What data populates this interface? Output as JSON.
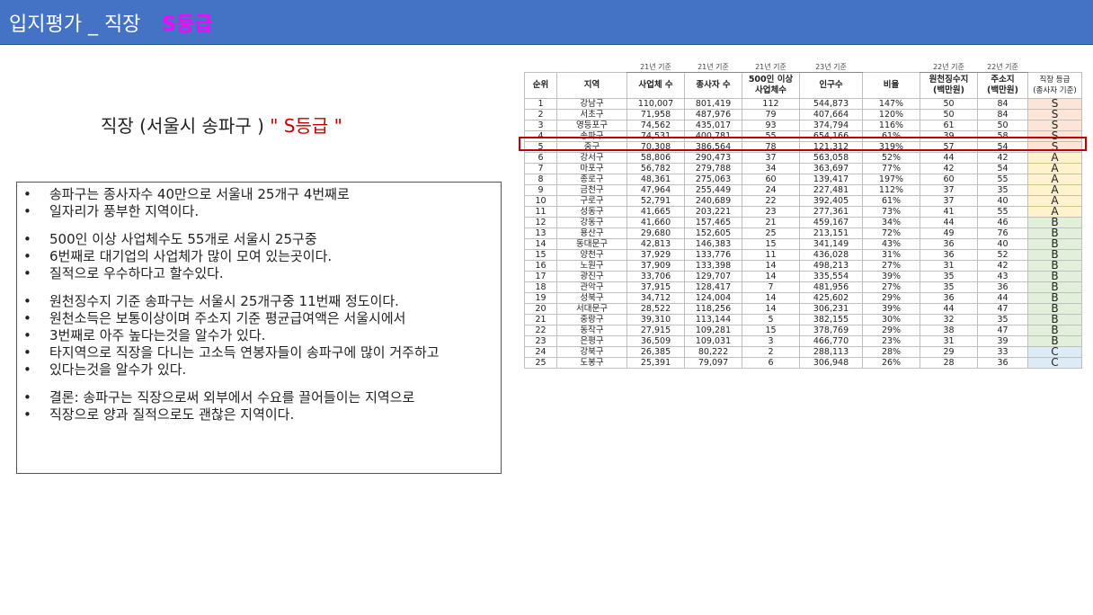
{
  "header": {
    "title": "입지평가 _ 직장",
    "grade": "S등급",
    "bg_color": "#4472c4",
    "grade_color": "#ff00ff"
  },
  "subtitle": {
    "prefix": "직장 (서울시 송파구 ) ",
    "quote": "\" S등급 \""
  },
  "bullets": [
    [
      "송파구는 종사자수 40만으로 서울내 25개구 4번째로",
      "일자리가 풍부한 지역이다."
    ],
    [
      "500인 이상 사업체수도 55개로 서울시 25구중",
      "6번째로 대기업의 사업체가 많이 모여 있는곳이다.",
      "질적으로 우수하다고 할수있다."
    ],
    [
      " 원천징수지 기준 송파구는 서울시 25개구중 11번째 정도이다.",
      "원천소득은 보통이상이며  주소지 기준 평균급여액은 서울시에서",
      "3번째로 아주 높다는것을 알수가 있다.",
      "타지역으로 직장을 다니는 고소득 연봉자들이 송파구에 많이 거주하고",
      "있다는것을 알수가 있다."
    ],
    [
      "결론: 송파구는 직장으로써 외부에서 수요를 끌어들이는 지역으로",
      "직장으로 양과 질적으로도 괜찮은 지역이다."
    ]
  ],
  "table": {
    "years": [
      "",
      "",
      "21년 기준",
      "21년 기준",
      "21년 기준",
      "23년 기준",
      "",
      "22년 기준",
      "22년 기준",
      ""
    ],
    "headers": [
      "순위",
      "지역",
      "사업체 수",
      "종사자 수",
      "500인 이상\n사업체수",
      "인구수",
      "비율",
      "원천징수지\n(백만원)",
      "주소지\n(백만원)",
      "직장 등급\n(종사자 기준)"
    ],
    "rows": [
      [
        "1",
        "강남구",
        "110,007",
        "801,419",
        "112",
        "544,873",
        "147%",
        "50",
        "84",
        "S"
      ],
      [
        "2",
        "서초구",
        "71,958",
        "487,976",
        "79",
        "407,664",
        "120%",
        "50",
        "84",
        "S"
      ],
      [
        "3",
        "영등포구",
        "74,562",
        "435,017",
        "93",
        "374,794",
        "116%",
        "61",
        "50",
        "S"
      ],
      [
        "4",
        "송파구",
        "74,531",
        "400,781",
        "55",
        "654,166",
        "61%",
        "39",
        "58",
        "S"
      ],
      [
        "5",
        "중구",
        "70,308",
        "386,564",
        "78",
        "121,312",
        "319%",
        "57",
        "54",
        "S"
      ],
      [
        "6",
        "강서구",
        "58,806",
        "290,473",
        "37",
        "563,058",
        "52%",
        "44",
        "42",
        "A"
      ],
      [
        "7",
        "마포구",
        "56,782",
        "279,788",
        "34",
        "363,697",
        "77%",
        "42",
        "54",
        "A"
      ],
      [
        "8",
        "종로구",
        "48,361",
        "275,063",
        "60",
        "139,417",
        "197%",
        "60",
        "55",
        "A"
      ],
      [
        "9",
        "금천구",
        "47,964",
        "255,449",
        "24",
        "227,481",
        "112%",
        "37",
        "35",
        "A"
      ],
      [
        "10",
        "구로구",
        "52,791",
        "240,689",
        "22",
        "392,405",
        "61%",
        "37",
        "40",
        "A"
      ],
      [
        "11",
        "성동구",
        "41,665",
        "203,221",
        "23",
        "277,361",
        "73%",
        "41",
        "55",
        "A"
      ],
      [
        "12",
        "강동구",
        "41,660",
        "157,465",
        "21",
        "459,167",
        "34%",
        "44",
        "46",
        "B"
      ],
      [
        "13",
        "용산구",
        "29,680",
        "152,605",
        "25",
        "213,151",
        "72%",
        "49",
        "76",
        "B"
      ],
      [
        "14",
        "동대문구",
        "42,813",
        "146,383",
        "15",
        "341,149",
        "43%",
        "36",
        "40",
        "B"
      ],
      [
        "15",
        "양천구",
        "37,929",
        "133,776",
        "11",
        "436,028",
        "31%",
        "36",
        "52",
        "B"
      ],
      [
        "16",
        "노원구",
        "37,909",
        "133,398",
        "14",
        "498,213",
        "27%",
        "31",
        "42",
        "B"
      ],
      [
        "17",
        "광진구",
        "33,706",
        "129,707",
        "14",
        "335,554",
        "39%",
        "35",
        "43",
        "B"
      ],
      [
        "18",
        "관악구",
        "37,915",
        "128,417",
        "7",
        "481,956",
        "27%",
        "35",
        "36",
        "B"
      ],
      [
        "19",
        "성북구",
        "34,712",
        "124,004",
        "14",
        "425,602",
        "29%",
        "36",
        "44",
        "B"
      ],
      [
        "20",
        "서대문구",
        "28,522",
        "118,256",
        "14",
        "306,231",
        "39%",
        "44",
        "47",
        "B"
      ],
      [
        "21",
        "중랑구",
        "39,310",
        "113,144",
        "5",
        "382,155",
        "30%",
        "32",
        "35",
        "B"
      ],
      [
        "22",
        "동작구",
        "27,915",
        "109,281",
        "15",
        "378,769",
        "29%",
        "38",
        "47",
        "B"
      ],
      [
        "23",
        "은평구",
        "36,509",
        "109,031",
        "3",
        "466,770",
        "23%",
        "31",
        "39",
        "B"
      ],
      [
        "24",
        "강북구",
        "26,385",
        "80,222",
        "2",
        "288,113",
        "28%",
        "29",
        "33",
        "C"
      ],
      [
        "25",
        "도봉구",
        "25,391",
        "79,097",
        "6",
        "306,948",
        "26%",
        "28",
        "36",
        "C"
      ]
    ],
    "grade_colors": {
      "S": "#fce4d6",
      "A": "#fff2cc",
      "B": "#e2efda",
      "C": "#ddebf7"
    },
    "highlight_row": "송파구",
    "highlight_color": "#c00000"
  }
}
